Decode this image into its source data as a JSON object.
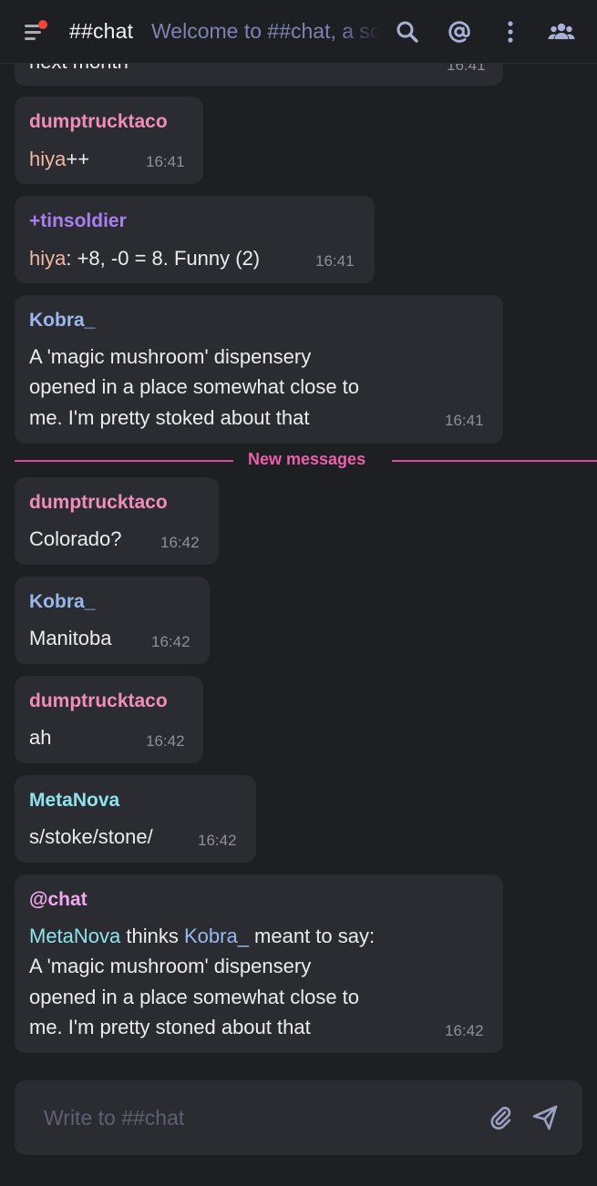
{
  "header": {
    "channel": "##chat",
    "topic": "Welcome to ##chat, a social channel"
  },
  "messages": [
    {
      "nick": "",
      "lines": [
        "next month"
      ],
      "time": "16:41"
    },
    {
      "nick": "dumptrucktaco",
      "parts": [
        {
          "text": "hiya",
          "style": "hilite"
        },
        {
          "text": "++"
        }
      ],
      "time": "16:41"
    },
    {
      "nick": "+tinsoldier",
      "parts": [
        {
          "text": "hiya",
          "style": "hilite"
        },
        {
          "text": ": +8, -0 = 8. Funny (2)"
        }
      ],
      "time": "16:41"
    },
    {
      "nick": "Kobra_",
      "lines": [
        "A 'magic mushroom' dispensery",
        "opened in a place somewhat close to",
        "me. I'm pretty stoked about that"
      ],
      "time": "16:41"
    },
    {
      "nick": "dumptrucktaco",
      "lines": [
        "Colorado?"
      ],
      "time": "16:42"
    },
    {
      "nick": "Kobra_",
      "lines": [
        "Manitoba"
      ],
      "time": "16:42"
    },
    {
      "nick": "dumptrucktaco",
      "lines": [
        "ah"
      ],
      "time": "16:42"
    },
    {
      "nick": "MetaNova",
      "lines": [
        "s/stoke/stone/"
      ],
      "time": "16:42"
    },
    {
      "nick": "@chat",
      "first_line": [
        {
          "text": "MetaNova",
          "style": "cyan"
        },
        {
          "text": " thinks "
        },
        {
          "text": "Kobra_",
          "style": "blue"
        },
        {
          "text": " meant to say:"
        }
      ],
      "lines": [
        "A 'magic mushroom' dispensery",
        "opened in a place somewhat close to",
        "me. I'm pretty stoned about that"
      ],
      "time": "16:42"
    }
  ],
  "divider": {
    "label": "New messages"
  },
  "composer": {
    "placeholder": "Write to ##chat"
  },
  "icons": [
    "menu-icon",
    "search-icon",
    "mention-icon",
    "more-icon",
    "members-icon",
    "attach-icon",
    "send-icon"
  ],
  "colors": {
    "accent": "#ec5fad",
    "background": "#1e1f22",
    "bubble": "#2b2c31"
  }
}
